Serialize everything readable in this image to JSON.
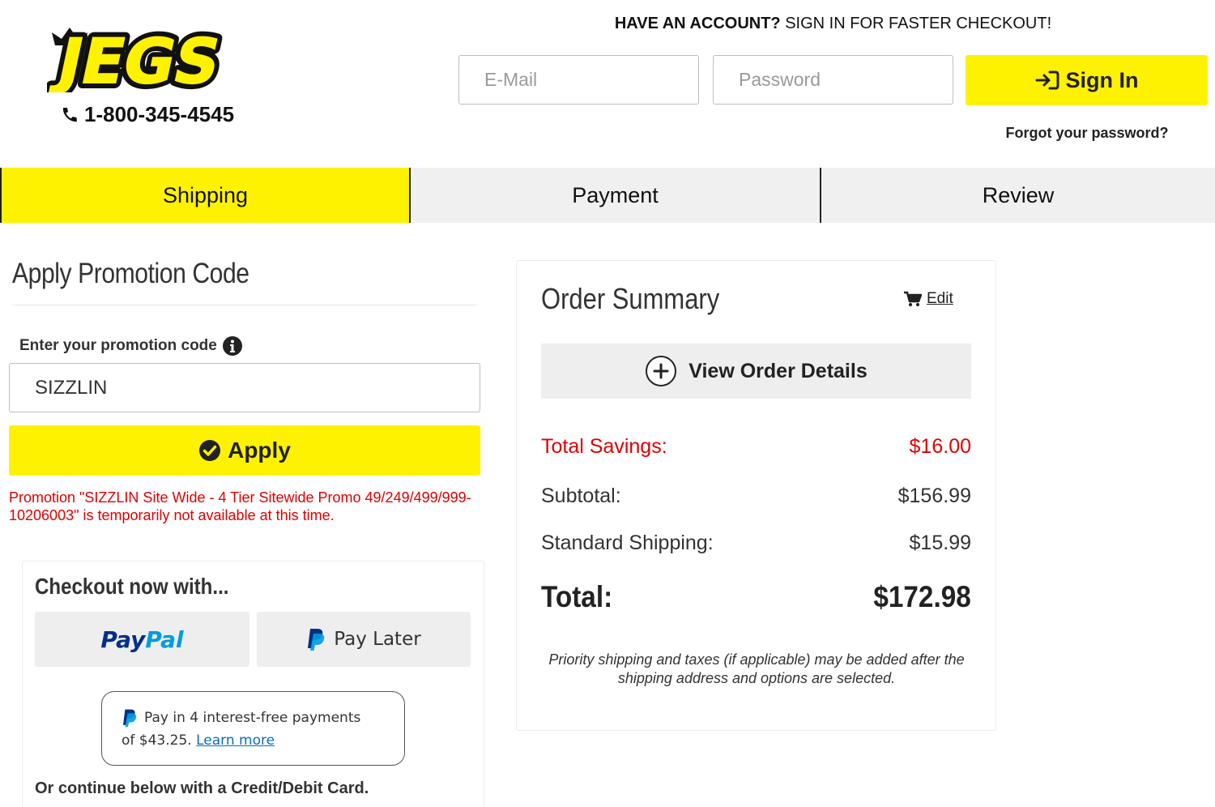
{
  "header": {
    "logo_text": "JEGS",
    "phone": "1-800-345-4545",
    "account_prompt_bold": "HAVE AN ACCOUNT?",
    "account_prompt_rest": " SIGN IN FOR FASTER CHECKOUT!",
    "email_placeholder": "E-Mail",
    "password_placeholder": "Password",
    "sign_in_label": "Sign In",
    "forgot_label": "Forgot your password?",
    "brand_yellow": "#fef200"
  },
  "steps": [
    {
      "label": "Shipping",
      "active": true
    },
    {
      "label": "Payment",
      "active": false
    },
    {
      "label": "Review",
      "active": false
    }
  ],
  "promo": {
    "title": "Apply Promotion Code",
    "field_label": "Enter your promotion code",
    "code_value": "SIZZLIN",
    "apply_label": "Apply",
    "error_message": "Promotion \"SIZZLIN Site Wide - 4 Tier Sitewide Promo 49/249/499/999-10206003\" is temporarily not available at this time.",
    "error_color": "#e00000"
  },
  "checkout": {
    "title": "Checkout now with...",
    "paypal_part1": "Pay",
    "paypal_part2": "Pal",
    "pay_later_label": "Pay Later",
    "pay4_line1": "Pay in 4 interest-free payments",
    "pay4_line2": "of $43.25.",
    "learn_more": "Learn more",
    "or_continue": "Or continue below with a Credit/Debit Card."
  },
  "summary": {
    "title": "Order Summary",
    "edit_label": "Edit",
    "view_details_label": "View Order Details",
    "savings_label": "Total Savings:",
    "savings_value": "$16.00",
    "subtotal_label": "Subtotal:",
    "subtotal_value": "$156.99",
    "shipping_label": "Standard Shipping:",
    "shipping_value": "$15.99",
    "total_label": "Total:",
    "total_value": "$172.98",
    "note": "Priority shipping and taxes (if applicable) may be added after the shipping address and options are selected."
  }
}
